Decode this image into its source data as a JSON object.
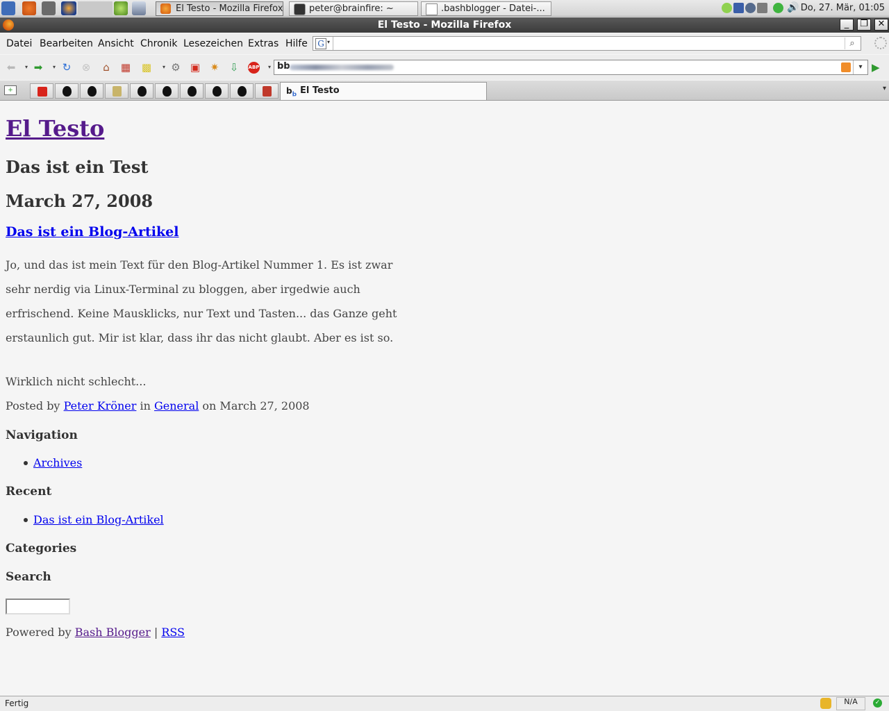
{
  "panel": {
    "tasks": [
      {
        "label": "El Testo - Mozilla Firefox",
        "active": true
      },
      {
        "label": "peter@brainfire: ~",
        "active": false
      },
      {
        "label": ".bashblogger - Datei-...",
        "active": false
      }
    ],
    "clock": "Do, 27. Mär, 01:05"
  },
  "window": {
    "title": "El Testo - Mozilla Firefox"
  },
  "menu": {
    "items": [
      "Datei",
      "Bearbeiten",
      "Ansicht",
      "Chronik",
      "Lesezeichen",
      "Extras",
      "Hilfe"
    ],
    "search_engine_icon": "G"
  },
  "nav": {
    "url_prefix": "bb"
  },
  "tabs": {
    "active_tab": "El Testo"
  },
  "page": {
    "blog_title": "El Testo",
    "blog_description": "Das ist ein Test",
    "date_heading": "March 27, 2008",
    "article_title": "Das ist ein Blog-Artikel",
    "article_body": "Jo, und das ist mein Text für den Blog-Artikel Nummer 1. Es ist zwar sehr nerdig via Linux-Terminal zu bloggen, aber irgedwie auch erfrischend. Keine Mausklicks, nur Text und Tasten... das Ganze geht erstaunlich gut. Mir ist klar, dass ihr das nicht glaubt. Aber es ist so.",
    "article_extra": "Wirklich nicht schlecht...",
    "meta": {
      "posted_by": "Posted by",
      "author": "Peter Kröner",
      "in": "in",
      "category": "General",
      "on": "on March 27, 2008"
    },
    "nav_heading": "Navigation",
    "nav_links": [
      "Archives"
    ],
    "recent_heading": "Recent",
    "recent_links": [
      "Das ist ein Blog-Artikel"
    ],
    "categories_heading": "Categories",
    "search_heading": "Search",
    "footer": {
      "powered_by": "Powered by",
      "engine": "Bash Blogger",
      "separator": "|",
      "rss": "RSS"
    }
  },
  "status": {
    "text": "Fertig",
    "na": "N/A"
  },
  "colors": {
    "visited_link": "#551a8b",
    "link": "#0000ee",
    "page_bg": "#f5f5f5"
  }
}
